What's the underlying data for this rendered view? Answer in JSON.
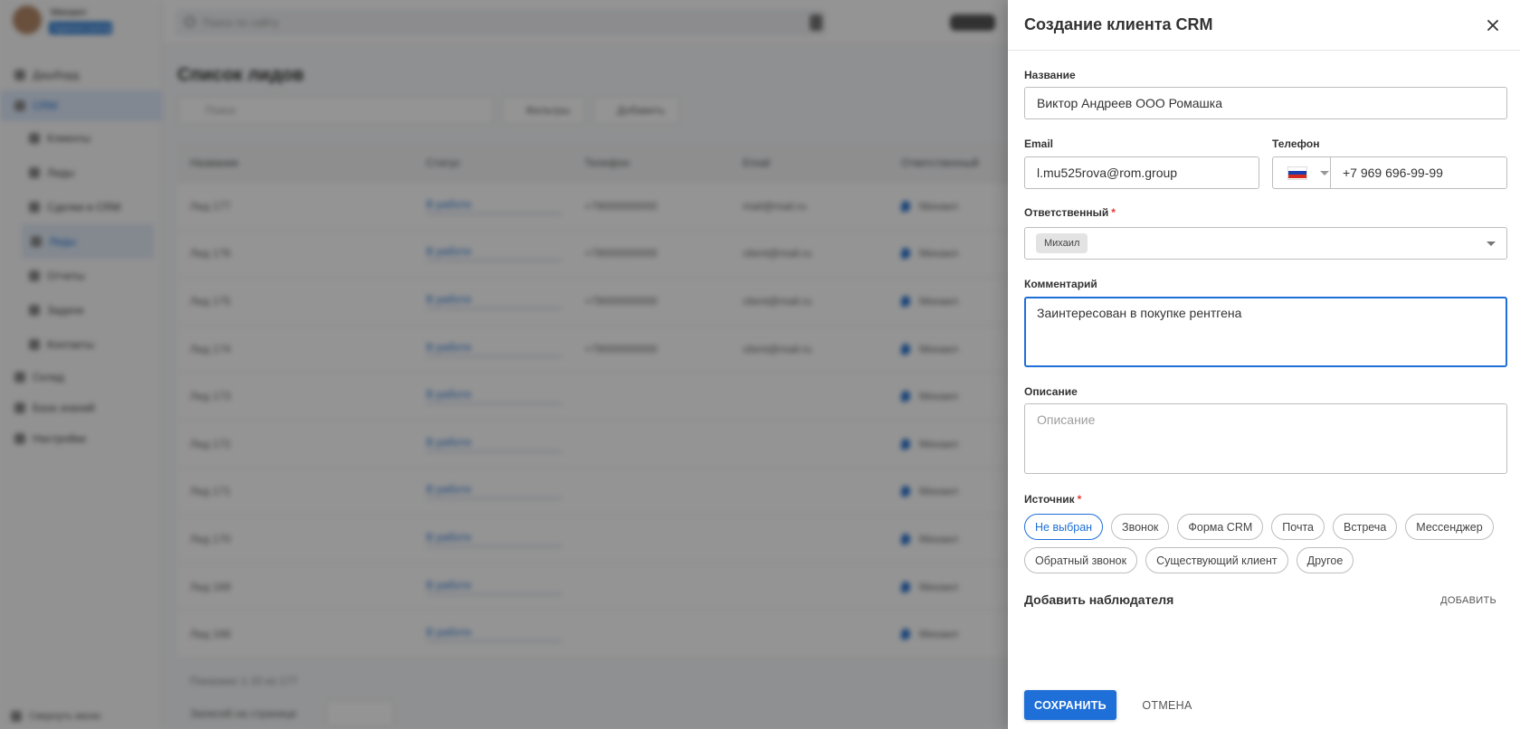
{
  "background": {
    "user_name": "Михаил",
    "user_role": "Администратор",
    "search_placeholder": "Поиск по сайту",
    "nav": [
      {
        "label": "Дашборд",
        "type": "top"
      },
      {
        "label": "CRM",
        "type": "active"
      },
      {
        "label": "Клиенты",
        "type": "sub"
      },
      {
        "label": "Лиды",
        "type": "sub"
      },
      {
        "label": "Сделки в CRM",
        "type": "sub"
      },
      {
        "label": "Лиды",
        "type": "active-sub"
      },
      {
        "label": "Отчеты",
        "type": "sub"
      },
      {
        "label": "Задачи",
        "type": "sub"
      },
      {
        "label": "Контакты",
        "type": "sub"
      },
      {
        "label": "Склад",
        "type": "top"
      },
      {
        "label": "База знаний",
        "type": "top"
      },
      {
        "label": "Настройки",
        "type": "top"
      }
    ],
    "nav_bottom": "Свернуть меню",
    "page_title": "Список лидов",
    "filter_placeholder": "Поиск",
    "toolbar_buttons": [
      "Фильтры",
      "Добавить"
    ],
    "table_headers": [
      "Название",
      "Статус",
      "Телефон",
      "Email",
      "Ответственный"
    ],
    "rows": [
      {
        "name": "Лид 177",
        "status": "В работе",
        "phone": "+79000000000",
        "email": "mail@mail.ru",
        "owner": "Михаил"
      },
      {
        "name": "Лид 176",
        "status": "В работе",
        "phone": "+79000000000",
        "email": "client@mail.ru",
        "owner": "Михаил"
      },
      {
        "name": "Лид 175",
        "status": "В работе",
        "phone": "+79000000000",
        "email": "client@mail.ru",
        "owner": "Михаил"
      },
      {
        "name": "Лид 174",
        "status": "В работе",
        "phone": "+79000000000",
        "email": "client@mail.ru",
        "owner": "Михаил"
      },
      {
        "name": "Лид 173",
        "status": "В работе",
        "phone": "",
        "email": "",
        "owner": "Михаил"
      },
      {
        "name": "Лид 172",
        "status": "В работе",
        "phone": "",
        "email": "",
        "owner": "Михаил"
      },
      {
        "name": "Лид 171",
        "status": "В работе",
        "phone": "",
        "email": "",
        "owner": "Михаил"
      },
      {
        "name": "Лид 170",
        "status": "В работе",
        "phone": "",
        "email": "",
        "owner": "Михаил"
      },
      {
        "name": "Лид 169",
        "status": "В работе",
        "phone": "",
        "email": "",
        "owner": "Михаил"
      },
      {
        "name": "Лид 168",
        "status": "В работе",
        "phone": "",
        "email": "",
        "owner": "Михаил"
      }
    ],
    "footer_count": "Показано 1-10 из 177",
    "footer_per_page": "Записей на странице"
  },
  "drawer": {
    "title": "Создание клиента CRM",
    "close_icon": "close-icon",
    "name_label": "Название",
    "name_value": "Виктор Андреев ООО Ромашка",
    "email_label": "Email",
    "email_value": "l.mu525rova@rom.group",
    "phone_label": "Телефон",
    "phone_value": "+7 969 696-99-99",
    "country_flag": "ru-flag-icon",
    "responsible_label": "Ответственный",
    "responsible_chip": "Михаил",
    "comment_label": "Комментарий",
    "comment_value": "Заинтересован в покупке рентгена",
    "description_label": "Описание",
    "description_placeholder": "Описание",
    "source_label": "Источник",
    "sources": [
      {
        "label": "Не выбран",
        "selected": true
      },
      {
        "label": "Звонок",
        "selected": false
      },
      {
        "label": "Форма CRM",
        "selected": false
      },
      {
        "label": "Почта",
        "selected": false
      },
      {
        "label": "Встреча",
        "selected": false
      },
      {
        "label": "Мессенджер",
        "selected": false
      },
      {
        "label": "Обратный звонок",
        "selected": false
      },
      {
        "label": "Существующий клиент",
        "selected": false
      },
      {
        "label": "Другое",
        "selected": false
      }
    ],
    "observer_title": "Добавить наблюдателя",
    "observer_add": "ДОБАВИТЬ",
    "save_label": "СОХРАНИТЬ",
    "cancel_label": "ОТМЕНА",
    "colors": {
      "primary": "#1e6fd8",
      "required": "#e53935"
    }
  }
}
